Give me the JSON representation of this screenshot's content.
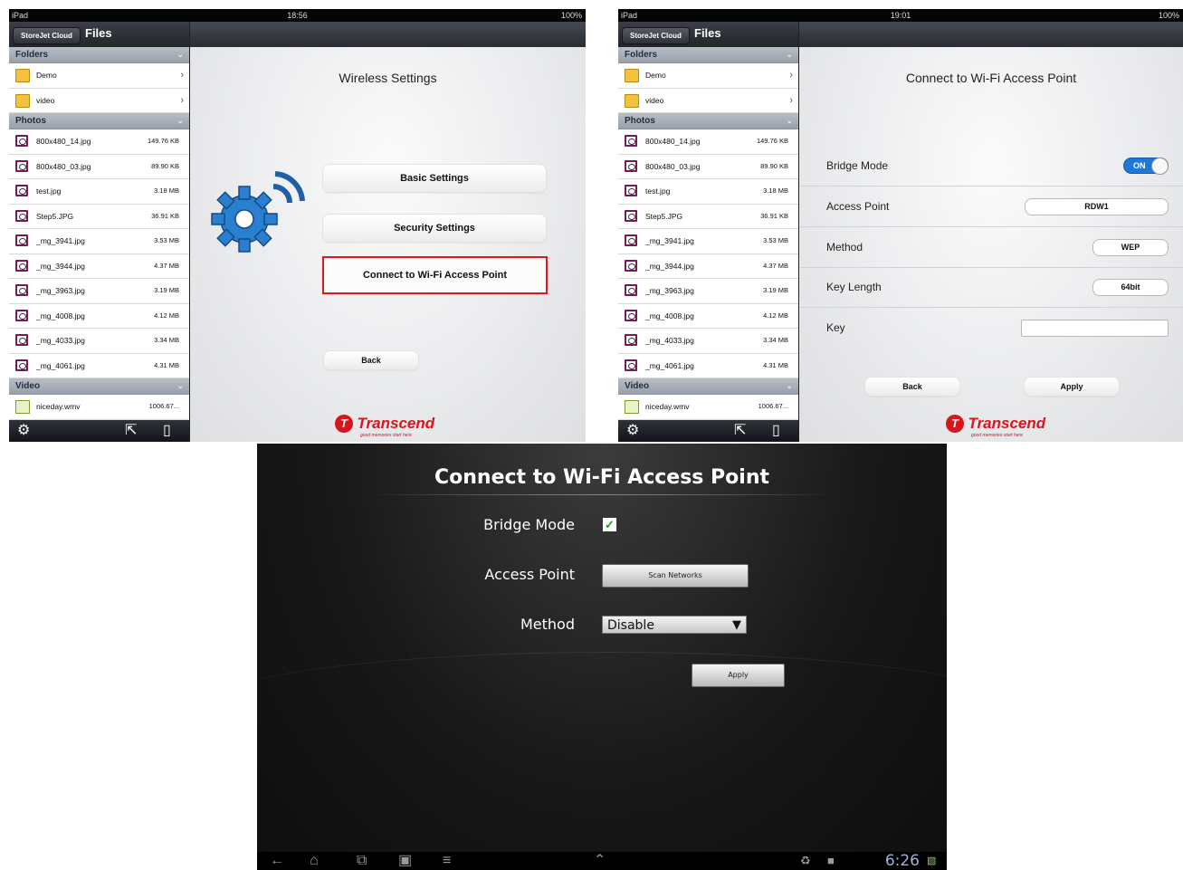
{
  "ipad": {
    "carrier": "iPad",
    "sidebar": {
      "cloud_button": "StoreJet Cloud",
      "title": "Files",
      "sections": {
        "folders": "Folders",
        "photos": "Photos",
        "video": "Video"
      },
      "folders": [
        "Demo",
        "video"
      ],
      "photos": [
        {
          "name": "800x480_14.jpg",
          "size": "149.76 KB"
        },
        {
          "name": "800x480_03.jpg",
          "size": "89.90 KB"
        },
        {
          "name": "test.jpg",
          "size": "3.18 MB"
        },
        {
          "name": "Step5.JPG",
          "size": "36.91 KB"
        },
        {
          "name": "_mg_3941.jpg",
          "size": "3.53 MB"
        },
        {
          "name": "_mg_3944.jpg",
          "size": "4.37 MB"
        },
        {
          "name": "_mg_3963.jpg",
          "size": "3.19 MB"
        },
        {
          "name": "_mg_4008.jpg",
          "size": "4.12 MB"
        },
        {
          "name": "_mg_4033.jpg",
          "size": "3.34 MB"
        },
        {
          "name": "_mg_4061.jpg",
          "size": "4.31 MB"
        }
      ],
      "videos": [
        {
          "name": "niceday.wmv",
          "size": "1006.67..."
        }
      ],
      "toolbar_icons": [
        "gear-icon",
        "share-icon",
        "device-icon"
      ]
    },
    "logo": {
      "brand": "Transcend",
      "tagline": "good memories start here"
    }
  },
  "screen1": {
    "time": "18:56",
    "battery": "100%",
    "title": "Wireless Settings",
    "buttons": {
      "basic": "Basic Settings",
      "security": "Security Settings",
      "connect": "Connect to Wi-Fi Access Point",
      "back": "Back"
    },
    "icon": "wireless-gear-icon"
  },
  "screen2": {
    "time": "19:01",
    "battery": "100%",
    "title": "Connect to Wi-Fi Access Point",
    "rows": {
      "bridge_label": "Bridge Mode",
      "bridge_value": "ON",
      "ap_label": "Access Point",
      "ap_value": "RDW1",
      "method_label": "Method",
      "method_value": "WEP",
      "keylen_label": "Key Length",
      "keylen_value": "64bit",
      "key_label": "Key",
      "key_value": ""
    },
    "buttons": {
      "back": "Back",
      "apply": "Apply"
    }
  },
  "android": {
    "title": "Connect to Wi-Fi Access Point",
    "bridge_label": "Bridge Mode",
    "bridge_checked": true,
    "ap_label": "Access Point",
    "scan_button": "Scan Networks",
    "method_label": "Method",
    "method_value": "Disable",
    "apply_button": "Apply",
    "clock": "6:26",
    "nav_icons": [
      "back-icon",
      "home-icon",
      "recent-apps-icon",
      "screenshot-icon",
      "menu-icon",
      "up-arrow-icon",
      "recycle-icon",
      "bag-icon",
      "signal-battery-icon"
    ],
    "check_color": "#19a019"
  },
  "colors": {
    "highlight_border": "#e01818",
    "toggle_on": "#1d78d8",
    "brand": "#d6151d"
  }
}
